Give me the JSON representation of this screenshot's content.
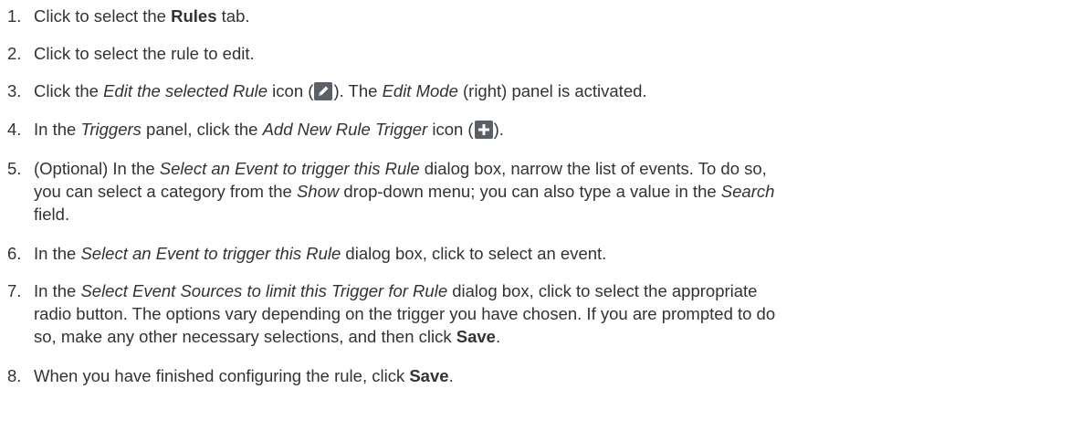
{
  "steps": [
    {
      "num": "1.",
      "t1": "Click to select the ",
      "b1": "Rules",
      "t2": " tab."
    },
    {
      "num": "2.",
      "t1": "Click to select the rule to edit."
    },
    {
      "num": "3.",
      "t1": "Click the ",
      "i1": "Edit the selected Rule",
      "t2": " icon (",
      "icon": "pencil-icon",
      "t3": "). The ",
      "i2": "Edit Mode",
      "t4": " (right) panel is activated."
    },
    {
      "num": "4.",
      "t1": "In the ",
      "i1": "Triggers",
      "t2": " panel, click the ",
      "i2": "Add New Rule Trigger",
      "t3": " icon (",
      "icon": "plus-icon",
      "t4": ")."
    },
    {
      "num": "5.",
      "l1_t1": "(Optional) In the ",
      "l1_i1": "Select an Event to trigger this Rule",
      "l1_t2": " dialog box, narrow the list of events. To do so,",
      "l2_t1": "you can select a category from the ",
      "l2_i1": "Show",
      "l2_t2": " drop-down menu; you can also type a value in the ",
      "l2_i2": "Search",
      "l3_t1": "field."
    },
    {
      "num": "6.",
      "t1": "In the ",
      "i1": "Select an Event to trigger this Rule",
      "t2": " dialog box, click to select an event."
    },
    {
      "num": "7.",
      "l1_t1": "In the ",
      "l1_i1": "Select Event Sources to limit this Trigger for Rule",
      "l1_t2": " dialog box, click to select the appropriate",
      "l2_t1": "radio button. The options vary depending on the trigger you have chosen. If you are prompted to do",
      "l3_t1": "so, make any other necessary selections, and then click ",
      "l3_b1": "Save",
      "l3_t2": "."
    },
    {
      "num": "8.",
      "t1": "When you have finished configuring the rule, click ",
      "b1": "Save",
      "t2": "."
    }
  ],
  "colors": {
    "text": "#333333",
    "icon_bg": "#5a6066"
  }
}
